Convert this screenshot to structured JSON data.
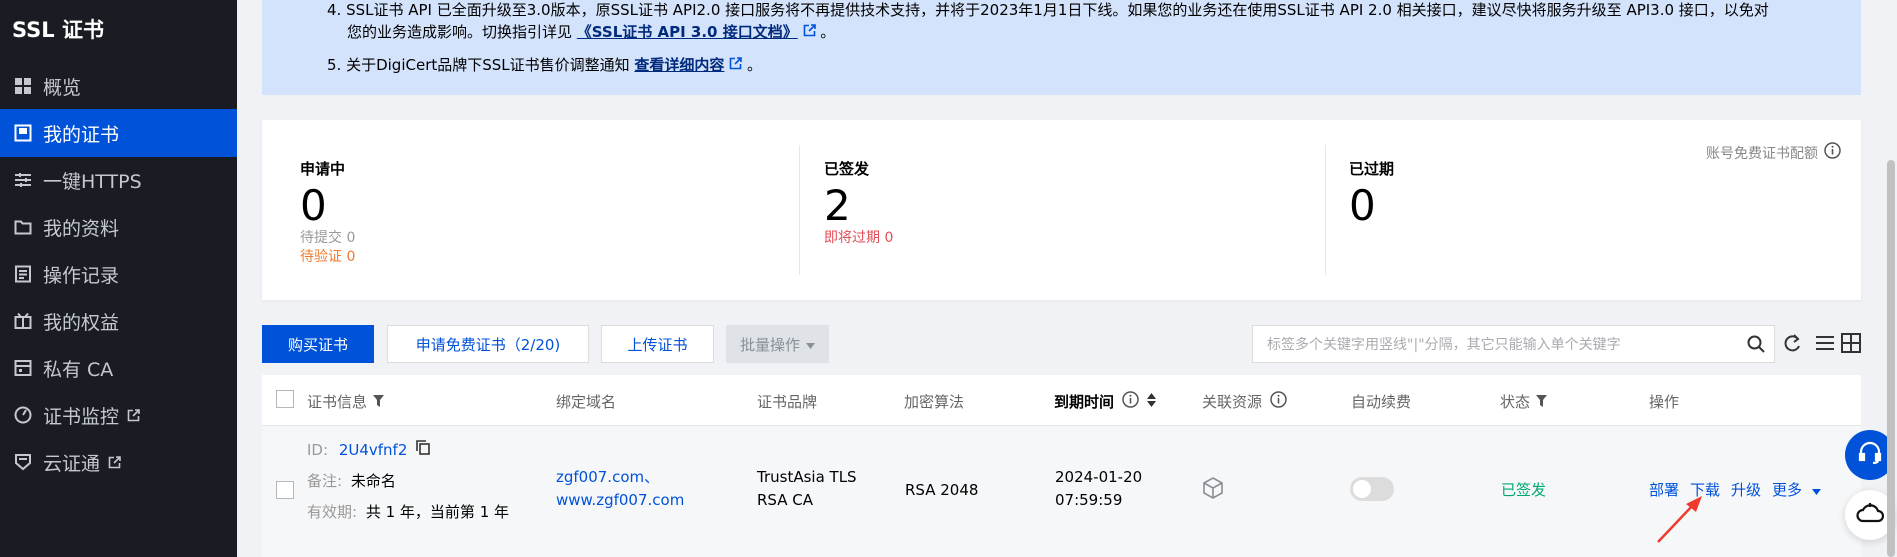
{
  "sidebar": {
    "title": "SSL 证书",
    "items": [
      {
        "label": "概览",
        "icon": "grid-icon"
      },
      {
        "label": "我的证书",
        "icon": "certificate-icon"
      },
      {
        "label": "一键HTTPS",
        "icon": "sliders-icon"
      },
      {
        "label": "我的资料",
        "icon": "folder-icon"
      },
      {
        "label": "操作记录",
        "icon": "log-icon"
      },
      {
        "label": "我的权益",
        "icon": "gift-icon"
      },
      {
        "label": "私有 CA",
        "icon": "building-icon"
      },
      {
        "label": "证书监控",
        "icon": "monitor-icon"
      },
      {
        "label": "云证通",
        "icon": "shield-card-icon"
      }
    ]
  },
  "notice": {
    "line4_a": "4. SSL证书 API 已全面升级至3.0版本，原SSL证书 API2.0 接口服务将不再提供技术支持，并将于2023年1月1日下线。如果您的业务还在使用SSL证书 API 2.0 相关接口，建议尽快将服务升级至 API3.0 接口，以免对",
    "line4_b": "您的业务造成影响。切换指引详见",
    "line4_link": "《SSL证书 API 3.0 接口文档》",
    "line4_end": "。",
    "line5_a": "5. 关于DigiCert品牌下SSL证书售价调整通知",
    "line5_link": "查看详细内容",
    "line5_end": "。"
  },
  "stats": {
    "applying": {
      "label": "申请中",
      "count": "0",
      "sub1": "待提交 0",
      "sub2": "待验证 0"
    },
    "issued": {
      "label": "已签发",
      "count": "2",
      "sub1": "即将过期 0"
    },
    "expired": {
      "label": "已过期",
      "count": "0"
    },
    "quota_label": "账号免费证书配额"
  },
  "toolbar": {
    "buy": "购买证书",
    "apply_free": "申请免费证书（2/20)",
    "upload": "上传证书",
    "batch": "批量操作",
    "search_placeholder": "标签多个关键字用竖线\"|\"分隔，其它只能输入单个关键字"
  },
  "table": {
    "headers": {
      "cert_info": "证书信息",
      "domain": "绑定域名",
      "brand": "证书品牌",
      "algo": "加密算法",
      "expire": "到期时间",
      "resource": "关联资源",
      "auto_renew": "自动续费",
      "status": "状态",
      "actions": "操作"
    },
    "row": {
      "id_label": "ID:",
      "id": "2U4vfnf2",
      "remark_label": "备注:",
      "remark": "未命名",
      "validity_label": "有效期:",
      "validity": "共 1 年，当前第 1 年",
      "domain1": "zgf007.com、",
      "domain2": "www.zgf007.com",
      "brand1": "TrustAsia TLS",
      "brand2": "RSA CA",
      "algo": "RSA 2048",
      "date": "2024-01-20",
      "time": "07:59:59",
      "auto_renew": false,
      "status": "已签发",
      "act_deploy": "部署",
      "act_download": "下载",
      "act_upgrade": "升级",
      "act_more": "更多"
    }
  },
  "colors": {
    "accent": "#0052d9",
    "sidebar_bg": "#191c23",
    "success": "#00a870",
    "danger": "#e34d59",
    "warning": "#ed7b2f",
    "annotation_arrow": "#f03a2e"
  }
}
